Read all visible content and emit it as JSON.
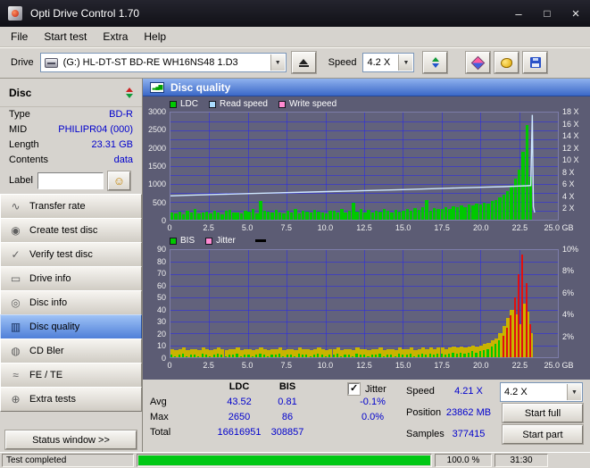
{
  "window": {
    "title": "Opti Drive Control 1.70"
  },
  "menu": {
    "items": [
      "File",
      "Start test",
      "Extra",
      "Help"
    ]
  },
  "toolbar": {
    "drive_label": "Drive",
    "drive_value": "(G:)  HL-DT-ST BD-RE  WH16NS48 1.D3",
    "speed_label": "Speed",
    "speed_value": "4.2 X"
  },
  "sidebar": {
    "section_title": "Disc",
    "info": [
      {
        "label": "Type",
        "value": "BD-R"
      },
      {
        "label": "MID",
        "value": "PHILIPR04 (000)"
      },
      {
        "label": "Length",
        "value": "23.31 GB"
      },
      {
        "label": "Contents",
        "value": "data"
      }
    ],
    "label_field": {
      "label": "Label",
      "value": ""
    },
    "buttons": [
      {
        "label": "Transfer rate",
        "icon": "transfer-rate-icon"
      },
      {
        "label": "Create test disc",
        "icon": "create-test-disc-icon"
      },
      {
        "label": "Verify test disc",
        "icon": "verify-test-disc-icon"
      },
      {
        "label": "Drive info",
        "icon": "drive-info-icon"
      },
      {
        "label": "Disc info",
        "icon": "disc-info-icon"
      },
      {
        "label": "Disc quality",
        "icon": "disc-quality-icon",
        "selected": true
      },
      {
        "label": "CD Bler",
        "icon": "cd-bler-icon"
      },
      {
        "label": "FE / TE",
        "icon": "fe-te-icon"
      },
      {
        "label": "Extra tests",
        "icon": "extra-tests-icon"
      }
    ],
    "status_window": "Status window >>"
  },
  "panel": {
    "title": "Disc quality"
  },
  "colors": {
    "ldc_green": "#00c800",
    "read_speed_line": "#cfe8ff",
    "write_speed_pink": "#ff8ad2",
    "jitter_yellow": "#c9b400",
    "bis_high_red": "#e01010",
    "selected_nav_blue": "#4f7fd8",
    "value_text_blue": "#0000cd",
    "progress_green": "#00c814"
  },
  "chart_data": [
    {
      "type": "bar",
      "name": "ldc-chart",
      "legend": [
        {
          "label": "LDC",
          "color": "#00c800"
        },
        {
          "label": "Read speed",
          "color": "#aadcff"
        },
        {
          "label": "Write speed",
          "color": "#ff8ad2"
        }
      ],
      "y_left": {
        "min": 0,
        "max": 3000,
        "ticks": [
          0,
          500,
          1000,
          1500,
          2000,
          2500,
          3000
        ]
      },
      "y_right": {
        "min": 0,
        "max": 18,
        "ticks": [
          2,
          4,
          6,
          8,
          10,
          12,
          14,
          16,
          18
        ],
        "suffix": " X"
      },
      "x": {
        "min": 0,
        "max": 25,
        "ticks": [
          "0",
          "2.5",
          "5.0",
          "7.5",
          "10.0",
          "12.5",
          "15.0",
          "17.5",
          "20.0",
          "22.5",
          "25.0 GB"
        ]
      },
      "data_end_gb": 23.4,
      "bars": {
        "series": "LDC",
        "color": "#00c800",
        "values": [
          200,
          180,
          220,
          160,
          250,
          190,
          300,
          170,
          210,
          230,
          180,
          260,
          200,
          150,
          240,
          280,
          190,
          210,
          170,
          250,
          220,
          300,
          180,
          520,
          260,
          230,
          190,
          280,
          210,
          170,
          240,
          200,
          310,
          180,
          250,
          220,
          190,
          270,
          230,
          200,
          180,
          260,
          240,
          210,
          290,
          200,
          250,
          480,
          230,
          310,
          200,
          270,
          190,
          240,
          220,
          300,
          250,
          210,
          280,
          230,
          260,
          300,
          240,
          320,
          280,
          350,
          560,
          260,
          330,
          290,
          310,
          350,
          300,
          380,
          340,
          400,
          360,
          420,
          390,
          450,
          420,
          480,
          450,
          520,
          560,
          620,
          700,
          800,
          950,
          1150,
          1400,
          1900,
          2650,
          1200
        ]
      },
      "line": {
        "series": "Read speed",
        "color": "#cfe8ff",
        "x": [
          0,
          1,
          3,
          6,
          9,
          12,
          15,
          18,
          20,
          21.5,
          22.5,
          23.0,
          23.25,
          23.35,
          23.42,
          23.5
        ],
        "y": [
          4.0,
          4.1,
          4.25,
          4.45,
          4.65,
          4.85,
          5.05,
          5.3,
          5.45,
          5.55,
          5.65,
          5.7,
          5.75,
          17.6,
          2.2,
          1.2
        ]
      }
    },
    {
      "type": "bar",
      "name": "bis-jitter-chart",
      "legend": [
        {
          "label": "BIS",
          "color": "#00c800"
        },
        {
          "label": "Jitter",
          "color": "#ff8ad2"
        }
      ],
      "marker_dash": true,
      "y_left": {
        "min": 0,
        "max": 90,
        "ticks": [
          0,
          10,
          20,
          30,
          40,
          50,
          60,
          70,
          80,
          90
        ]
      },
      "y_right": {
        "min": 0,
        "max": 10,
        "ticks": [
          2,
          4,
          6,
          8,
          10
        ],
        "suffix": "%"
      },
      "x": {
        "min": 0,
        "max": 25,
        "ticks": [
          "0",
          "2.5",
          "5.0",
          "7.5",
          "10.0",
          "12.5",
          "15.0",
          "17.5",
          "20.0",
          "22.5",
          "25.0 GB"
        ]
      },
      "data_end_gb": 23.4,
      "jitter": {
        "series": "Jitter",
        "color": "#c9b400",
        "values": [
          7,
          6,
          7,
          8,
          6,
          7,
          7,
          6,
          8,
          7,
          6,
          7,
          8,
          7,
          6,
          7,
          7,
          8,
          6,
          7,
          7,
          6,
          7,
          8,
          7,
          6,
          7,
          7,
          8,
          6,
          7,
          7,
          6,
          8,
          7,
          7,
          6,
          7,
          8,
          7,
          6,
          7,
          7,
          8,
          6,
          7,
          7,
          6,
          8,
          7,
          7,
          6,
          7,
          7,
          8,
          6,
          7,
          7,
          6,
          8,
          7,
          7,
          8,
          6,
          7,
          8,
          7,
          8,
          7,
          8,
          8,
          7,
          8,
          9,
          8,
          9,
          8,
          9,
          10,
          9,
          10,
          11,
          12,
          14,
          16,
          20,
          26,
          33,
          40,
          36,
          28,
          45,
          38,
          20
        ]
      },
      "bis": {
        "series": "BIS",
        "color": "#00c800",
        "high_color": "#e01010",
        "high_threshold": 15,
        "values": [
          2,
          1,
          2,
          3,
          1,
          2,
          2,
          1,
          3,
          2,
          1,
          2,
          3,
          2,
          1,
          2,
          2,
          3,
          1,
          2,
          2,
          1,
          2,
          3,
          2,
          1,
          2,
          2,
          3,
          1,
          2,
          2,
          1,
          3,
          2,
          2,
          1,
          2,
          3,
          2,
          1,
          2,
          2,
          3,
          1,
          2,
          2,
          1,
          3,
          2,
          2,
          1,
          2,
          2,
          3,
          1,
          2,
          2,
          1,
          3,
          2,
          2,
          3,
          1,
          2,
          3,
          2,
          3,
          2,
          3,
          3,
          2,
          3,
          4,
          3,
          4,
          3,
          4,
          5,
          4,
          5,
          6,
          7,
          9,
          11,
          14,
          18,
          25,
          35,
          50,
          70,
          86,
          62,
          28
        ]
      }
    }
  ],
  "stats": {
    "col_headers": [
      "LDC",
      "BIS"
    ],
    "rows": [
      {
        "label": "Avg",
        "ldc": "43.52",
        "bis": "0.81"
      },
      {
        "label": "Max",
        "ldc": "2650",
        "bis": "86"
      },
      {
        "label": "Total",
        "ldc": "16616951",
        "bis": "308857"
      }
    ],
    "jitter": {
      "label": "Jitter",
      "checked": true,
      "values": [
        "-0.1%",
        "0.0%"
      ]
    },
    "speed": {
      "label": "Speed",
      "value": "4.21 X",
      "dropdown": "4.2 X"
    },
    "position": {
      "label": "Position",
      "value": "23862 MB",
      "button": "Start full"
    },
    "samples": {
      "label": "Samples",
      "value": "377415",
      "button": "Start part"
    }
  },
  "statusbar": {
    "status": "Test completed",
    "progress": 100,
    "percent": "100.0 %",
    "time": "31:30"
  }
}
